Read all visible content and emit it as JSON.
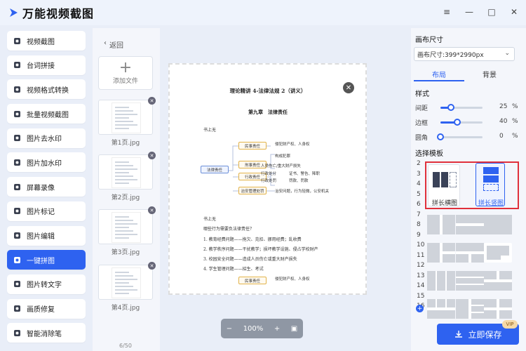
{
  "app": {
    "title": "万能视频截图"
  },
  "window_controls": [
    "≡",
    "—",
    "□",
    "✕"
  ],
  "sidebar": {
    "items": [
      {
        "label": "视频截图",
        "icon": "video-capture-icon"
      },
      {
        "label": "台词拼接",
        "icon": "caption-stitch-icon"
      },
      {
        "label": "视频格式转换",
        "icon": "format-convert-icon"
      },
      {
        "label": "批量视频截图",
        "icon": "batch-capture-icon"
      },
      {
        "label": "图片去水印",
        "icon": "remove-watermark-icon"
      },
      {
        "label": "图片加水印",
        "icon": "add-watermark-icon"
      },
      {
        "label": "屏幕录像",
        "icon": "screen-record-icon"
      },
      {
        "label": "图片标记",
        "icon": "image-mark-icon"
      },
      {
        "label": "图片编辑",
        "icon": "image-edit-icon"
      },
      {
        "label": "一键拼图",
        "icon": "collage-icon",
        "active": true
      },
      {
        "label": "图片转文字",
        "icon": "image-to-text-icon"
      },
      {
        "label": "画质修复",
        "icon": "quality-repair-icon"
      },
      {
        "label": "智能消除笔",
        "icon": "smart-eraser-icon"
      }
    ]
  },
  "files": {
    "back_label": "返回",
    "add_label": "添加文件",
    "thumbs": [
      "第1页.jpg",
      "第2页.jpg",
      "第3页.jpg",
      "第4页.jpg"
    ],
    "page_count": "6/50"
  },
  "document": {
    "title": "理论精讲 4-法律法规 2（讲义）",
    "chapter": "第九章　法律责任",
    "sub": "书上无",
    "root": "法律责任",
    "nodes": [
      "民事责任",
      "刑事责任",
      "行政责任",
      "治安管理处罚"
    ],
    "leaves": [
      "侵犯财产权、人身权",
      "构成犯罪",
      "人员伤亡/重大财产损失",
      "行政处分",
      "证书、警告、降职",
      "行政处罚",
      "罚款、罚款",
      "治安问题，行为轻微，公安机关"
    ],
    "sub2": "书上无",
    "question": "哪些行为需要负法律责任？",
    "lines": [
      "1. 教育经费问题——拖欠、克扣、挪用经费；乱收费",
      "2. 教学秩序问题——干扰教学；损坏教学设施、侵占学校财产",
      "3. 校园安全问题——造成人员伤亡或重大财产损失",
      "4. 学生管理问题——招生、考试"
    ],
    "node_bottom": "民事责任",
    "leaf_bottom": "侵犯财产权、人身权"
  },
  "zoom": {
    "level": "100%",
    "minus": "−",
    "plus": "+"
  },
  "right": {
    "canvas_size_title": "画布尺寸",
    "canvas_size_value": "画布尺寸:399*2990px",
    "tabs": [
      "布局",
      "背景"
    ],
    "style_title": "样式",
    "sliders": [
      {
        "label": "间距",
        "value": "25",
        "unit": "%",
        "ratio": 0.25
      },
      {
        "label": "边框",
        "value": "40",
        "unit": "%",
        "ratio": 0.4
      },
      {
        "label": "圆角",
        "value": "0",
        "unit": "%",
        "ratio": 0
      }
    ],
    "template_title": "选择模板",
    "numbers": [
      "2",
      "3",
      "4",
      "5",
      "6",
      "7",
      "8",
      "9",
      "10",
      "11",
      "12",
      "13",
      "14",
      "15",
      "16"
    ],
    "templates": [
      {
        "label": "拼长横图"
      },
      {
        "label": "拼长竖图",
        "selected": true
      }
    ],
    "save_label": "立即保存",
    "vip_label": "VIP"
  },
  "colors": {
    "accent": "#2e62f0",
    "highlight": "#e0303b"
  }
}
